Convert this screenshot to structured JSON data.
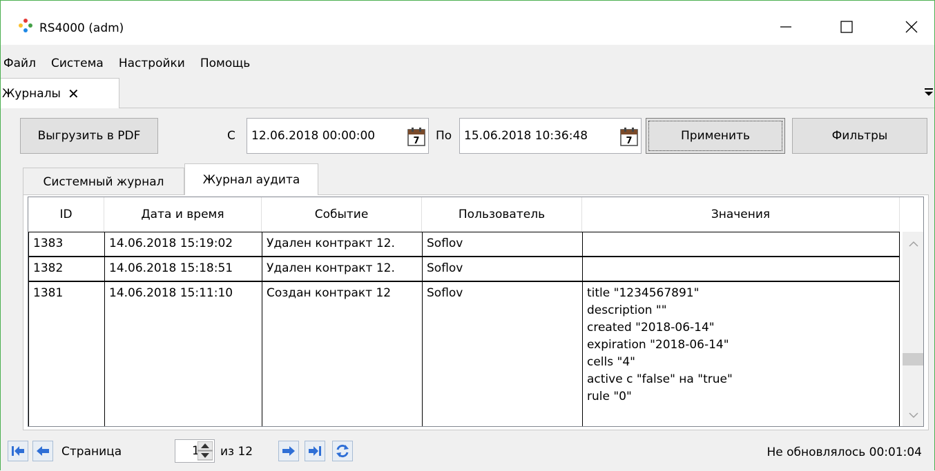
{
  "window": {
    "title": "RS4000 (adm)"
  },
  "menu": [
    "Файл",
    "Система",
    "Настройки",
    "Помощь"
  ],
  "doc_tab": {
    "label": "Журналы"
  },
  "toolbar": {
    "export_pdf": "Выгрузить в PDF",
    "from_label": "С",
    "from_value": "12.06.2018 00:00:00",
    "to_label": "По",
    "to_value": "15.06.2018 10:36:48",
    "apply": "Применить",
    "filters": "Фильтры"
  },
  "tabs": [
    "Системный журнал",
    "Журнал аудита"
  ],
  "grid": {
    "columns": [
      "ID",
      "Дата и время",
      "Событие",
      "Пользователь",
      "Значения"
    ],
    "rows": [
      {
        "id": "1383",
        "date": "14.06.2018 15:19:02",
        "event": "Удален контракт 12.",
        "user": "Soflov",
        "values": []
      },
      {
        "id": "1382",
        "date": "14.06.2018 15:18:51",
        "event": "Удален контракт 12.",
        "user": "Soflov",
        "values": []
      },
      {
        "id": "1381",
        "date": "14.06.2018 15:11:10",
        "event": "Создан контракт 12",
        "user": "Soflov",
        "values": [
          "title \"1234567891\"",
          "description \"\"",
          "created \"2018-06-14\"",
          "expiration \"2018-06-14\"",
          "cells \"4\"",
          "active с \"false\" на \"true\"",
          "rule \"0\""
        ]
      }
    ]
  },
  "pager": {
    "page_label": "Страница",
    "page_value": "1",
    "of_label": "из 12",
    "status": "Не обновлялось 00:01:04"
  },
  "colors": {
    "accent_green": "#4caf50",
    "nav_blue": "#2f6fd6"
  }
}
